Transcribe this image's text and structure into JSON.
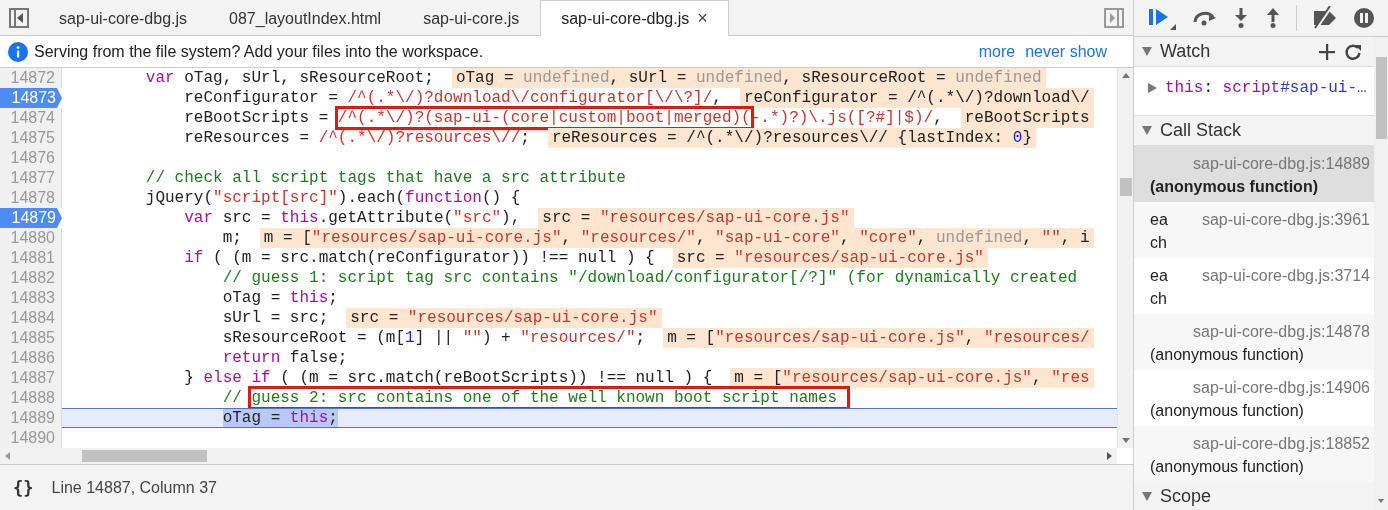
{
  "tabs": [
    {
      "label": "sap-ui-core-dbg.js",
      "selected": false
    },
    {
      "label": "087_layoutIndex.html",
      "selected": false
    },
    {
      "label": "sap-ui-core.js",
      "selected": false
    },
    {
      "label": "sap-ui-core-dbg.js",
      "selected": true,
      "close": "×"
    }
  ],
  "infobar": {
    "message": "Serving from the file system? Add your files into the workspace.",
    "links": [
      "more",
      "never show"
    ]
  },
  "lines": [
    {
      "number": "14872",
      "breakpoint": false,
      "current": false,
      "code": [
        {
          "kind": "keyword",
          "text": "        var"
        },
        {
          "kind": "plain",
          "text": " oTag, sUrl, sResourceRoot;"
        }
      ],
      "value": [
        {
          "kind": "plain",
          "text": "oTag = "
        },
        {
          "kind": "undefined",
          "text": "undefined"
        },
        {
          "kind": "plain",
          "text": ", sUrl = "
        },
        {
          "kind": "undefined",
          "text": "undefined"
        },
        {
          "kind": "plain",
          "text": ", sResourceRoot = "
        },
        {
          "kind": "undefined",
          "text": "undefined"
        }
      ]
    },
    {
      "number": "14873",
      "breakpoint": true,
      "current": false,
      "code": [
        {
          "kind": "plain",
          "text": "            reConfigurator = "
        },
        {
          "kind": "regex",
          "text": "/^(.*\\/)?download\\/configurator[\\/\\?]/"
        },
        {
          "kind": "plain",
          "text": ","
        }
      ],
      "value": [
        {
          "kind": "plain",
          "text": "reConfigurator = /^(.*\\/)?download\\/"
        }
      ]
    },
    {
      "number": "14874",
      "breakpoint": false,
      "current": false,
      "code": [
        {
          "kind": "plain",
          "text": "            reBootScripts = "
        },
        {
          "kind": "regex",
          "text": "/^(.*\\/)?(sap-ui-(core|custom|boot|merged)(",
          "boxed": true
        },
        {
          "kind": "regex",
          "text": "-.*)?)\\.js([?#]|$)/"
        },
        {
          "kind": "plain",
          "text": ","
        }
      ],
      "value": [
        {
          "kind": "plain",
          "text": "reBootScripts"
        }
      ]
    },
    {
      "number": "14875",
      "breakpoint": false,
      "current": false,
      "code": [
        {
          "kind": "plain",
          "text": "            reResources = "
        },
        {
          "kind": "regex",
          "text": "/^(.*\\/)?resources\\//"
        },
        {
          "kind": "plain",
          "text": ";"
        }
      ],
      "value": [
        {
          "kind": "plain",
          "text": "reResources = /^(.*\\/)?resources\\// {lastIndex: "
        },
        {
          "kind": "number",
          "text": "0"
        },
        {
          "kind": "plain",
          "text": "}"
        }
      ]
    },
    {
      "number": "14876",
      "breakpoint": false,
      "current": false
    },
    {
      "number": "14877",
      "breakpoint": false,
      "current": false,
      "code": [
        {
          "kind": "comment",
          "text": "        // check all script tags that have a src attribute"
        }
      ]
    },
    {
      "number": "14878",
      "breakpoint": false,
      "current": false,
      "code": [
        {
          "kind": "plain",
          "text": "        jQuery("
        },
        {
          "kind": "string",
          "text": "\"script[src]\""
        },
        {
          "kind": "plain",
          "text": ").each("
        },
        {
          "kind": "keyword",
          "text": "function"
        },
        {
          "kind": "plain",
          "text": "() {"
        }
      ]
    },
    {
      "number": "14879",
      "breakpoint": true,
      "current": false,
      "code": [
        {
          "kind": "keyword",
          "text": "            var"
        },
        {
          "kind": "plain",
          "text": " src = "
        },
        {
          "kind": "keyword",
          "text": "this"
        },
        {
          "kind": "plain",
          "text": ".getAttribute("
        },
        {
          "kind": "string",
          "text": "\"src\""
        },
        {
          "kind": "plain",
          "text": "),"
        }
      ],
      "value": [
        {
          "kind": "plain",
          "text": "src = "
        },
        {
          "kind": "string",
          "text": "\"resources/sap-ui-core.js\""
        }
      ]
    },
    {
      "number": "14880",
      "breakpoint": false,
      "current": false,
      "code": [
        {
          "kind": "plain",
          "text": "                m;"
        }
      ],
      "value": [
        {
          "kind": "plain",
          "text": "m = ["
        },
        {
          "kind": "string",
          "text": "\"resources/sap-ui-core.js\""
        },
        {
          "kind": "plain",
          "text": ", "
        },
        {
          "kind": "string",
          "text": "\"resources/\""
        },
        {
          "kind": "plain",
          "text": ", "
        },
        {
          "kind": "string",
          "text": "\"sap-ui-core\""
        },
        {
          "kind": "plain",
          "text": ", "
        },
        {
          "kind": "string",
          "text": "\"core\""
        },
        {
          "kind": "plain",
          "text": ", "
        },
        {
          "kind": "undefined",
          "text": "undefined"
        },
        {
          "kind": "plain",
          "text": ", "
        },
        {
          "kind": "string",
          "text": "\"\""
        },
        {
          "kind": "plain",
          "text": ", i"
        }
      ]
    },
    {
      "number": "14881",
      "breakpoint": false,
      "current": false,
      "code": [
        {
          "kind": "keyword",
          "text": "            if"
        },
        {
          "kind": "plain",
          "text": " ( (m = src.match(reConfigurator)) !== null ) {"
        }
      ],
      "value": [
        {
          "kind": "plain",
          "text": "src = "
        },
        {
          "kind": "string",
          "text": "\"resources/sap-ui-core.js\""
        }
      ]
    },
    {
      "number": "14882",
      "breakpoint": false,
      "current": false,
      "code": [
        {
          "kind": "comment",
          "text": "                // guess 1: script tag src contains \"/download/configurator[/?]\" (for dynamically created"
        }
      ]
    },
    {
      "number": "14883",
      "breakpoint": false,
      "current": false,
      "code": [
        {
          "kind": "plain",
          "text": "                oTag = "
        },
        {
          "kind": "keyword",
          "text": "this"
        },
        {
          "kind": "plain",
          "text": ";"
        }
      ]
    },
    {
      "number": "14884",
      "breakpoint": false,
      "current": false,
      "code": [
        {
          "kind": "plain",
          "text": "                sUrl = src;"
        }
      ],
      "value": [
        {
          "kind": "plain",
          "text": "src = "
        },
        {
          "kind": "string",
          "text": "\"resources/sap-ui-core.js\""
        }
      ]
    },
    {
      "number": "14885",
      "breakpoint": false,
      "current": false,
      "code": [
        {
          "kind": "plain",
          "text": "                sResourceRoot = (m["
        },
        {
          "kind": "number",
          "text": "1"
        },
        {
          "kind": "plain",
          "text": "] || "
        },
        {
          "kind": "string",
          "text": "\"\""
        },
        {
          "kind": "plain",
          "text": ") + "
        },
        {
          "kind": "string",
          "text": "\"resources/\""
        },
        {
          "kind": "plain",
          "text": ";"
        }
      ],
      "value": [
        {
          "kind": "plain",
          "text": "m = ["
        },
        {
          "kind": "string",
          "text": "\"resources/sap-ui-core.js\""
        },
        {
          "kind": "plain",
          "text": ", "
        },
        {
          "kind": "string",
          "text": "\"resources/"
        }
      ]
    },
    {
      "number": "14886",
      "breakpoint": false,
      "current": false,
      "code": [
        {
          "kind": "keyword",
          "text": "                return"
        },
        {
          "kind": "plain",
          "text": " false;"
        }
      ]
    },
    {
      "number": "14887",
      "breakpoint": false,
      "current": false,
      "code": [
        {
          "kind": "plain",
          "text": "            } "
        },
        {
          "kind": "keyword",
          "text": "else if"
        },
        {
          "kind": "plain",
          "text": " ( (m = src.match(reBootScripts)) !== null ) {"
        }
      ],
      "value": [
        {
          "kind": "plain",
          "text": "m = ["
        },
        {
          "kind": "string",
          "text": "\"resources/sap-ui-core.js\""
        },
        {
          "kind": "plain",
          "text": ", "
        },
        {
          "kind": "string",
          "text": "\"res"
        }
      ]
    },
    {
      "number": "14888",
      "breakpoint": false,
      "current": false,
      "code": [
        {
          "kind": "comment",
          "text": "                // "
        },
        {
          "kind": "comment",
          "text": "guess 2: src contains one of the well known boot script names ",
          "boxed": true
        }
      ]
    },
    {
      "number": "14889",
      "breakpoint": false,
      "current": true,
      "code": [
        {
          "kind": "plain",
          "text": "                oTag = ",
          "selected": true
        },
        {
          "kind": "keyword",
          "text": "this",
          "selected": true
        },
        {
          "kind": "plain",
          "text": ";",
          "selected": true
        }
      ]
    },
    {
      "number": "14890",
      "breakpoint": false,
      "current": false
    }
  ],
  "status_bar": {
    "format_button": "{}",
    "position": "Line 14887, Column 37"
  },
  "sidebar": {
    "sections": [
      {
        "kind": "watch",
        "title": "Watch",
        "expanded": true,
        "items": [
          {
            "expanded": false,
            "tokens": [
              {
                "kind": "keyword",
                "text": "this"
              },
              {
                "kind": "plain",
                "text": ": "
              },
              {
                "kind": "keyword",
                "text": "script"
              },
              {
                "kind": "id",
                "text": "#sap-ui-…"
              }
            ]
          }
        ]
      },
      {
        "kind": "callstack",
        "title": "Call Stack",
        "expanded": true,
        "frames": [
          {
            "function": "(anonymous function)",
            "location": "sap-ui-core-dbg.js:14889",
            "selected": true
          },
          {
            "function": "each",
            "location": "sap-ui-core-dbg.js:3961",
            "selected": false
          },
          {
            "function": "each",
            "location": "sap-ui-core-dbg.js:3714",
            "selected": false
          },
          {
            "function": "(anonymous function)",
            "location": "sap-ui-core-dbg.js:14878",
            "selected": false
          },
          {
            "function": "(anonymous function)",
            "location": "sap-ui-core-dbg.js:14906",
            "selected": false
          },
          {
            "function": "(anonymous function)",
            "location": "sap-ui-core-dbg.js:18852",
            "selected": false
          }
        ]
      },
      {
        "kind": "scope",
        "title": "Scope",
        "expanded": true
      }
    ]
  }
}
